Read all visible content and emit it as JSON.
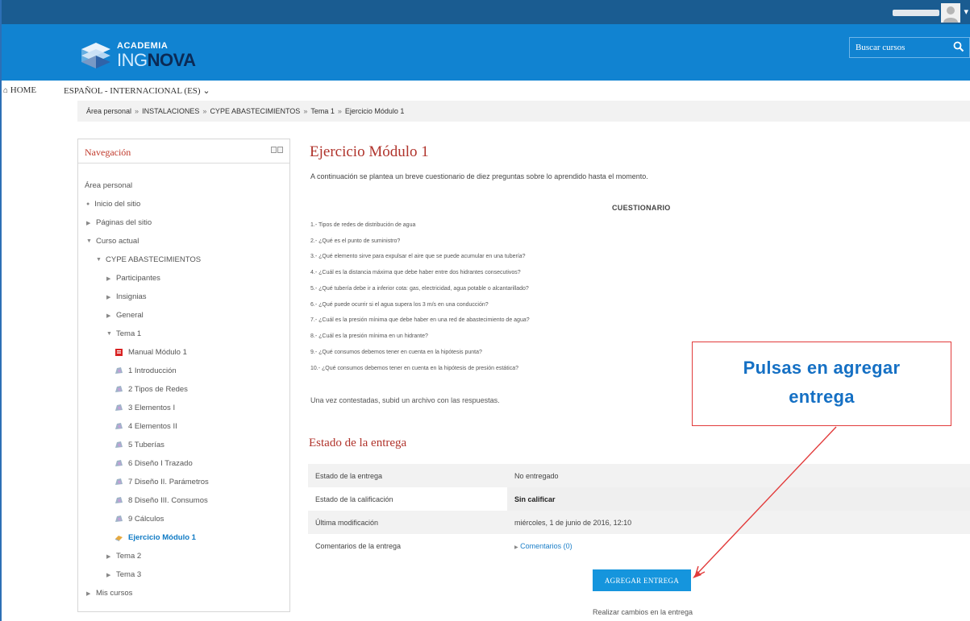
{
  "header": {
    "logo_line1": "ACADEMIA",
    "logo_ing": "ING",
    "logo_nova": "NOVA",
    "search_placeholder": "Buscar cursos"
  },
  "navbar": {
    "home": "HOME",
    "language": "ESPAÑOL - INTERNACIONAL (ES)"
  },
  "breadcrumb": [
    "Área personal",
    "INSTALACIONES",
    "CYPE ABASTECIMIENTOS",
    "Tema 1",
    "Ejercicio Módulo 1"
  ],
  "navigation": {
    "title": "Navegación",
    "items": [
      {
        "label": "Área personal"
      },
      {
        "label": "Inicio del sitio"
      },
      {
        "label": "Páginas del sitio"
      },
      {
        "label": "Curso actual"
      },
      {
        "label": "CYPE ABASTECIMIENTOS"
      },
      {
        "label": "Participantes"
      },
      {
        "label": "Insignias"
      },
      {
        "label": "General"
      },
      {
        "label": "Tema 1"
      },
      {
        "label": "Manual Módulo 1"
      },
      {
        "label": "1 Introducción"
      },
      {
        "label": "2 Tipos de Redes"
      },
      {
        "label": "3 Elementos I"
      },
      {
        "label": "4 Elementos II"
      },
      {
        "label": "5 Tuberías"
      },
      {
        "label": "6 Diseño I Trazado"
      },
      {
        "label": "7 Diseño II. Parámetros"
      },
      {
        "label": "8 Diseño III. Consumos"
      },
      {
        "label": "9 Cálculos"
      },
      {
        "label": "Ejercicio Módulo 1"
      },
      {
        "label": "Tema 2"
      },
      {
        "label": "Tema 3"
      },
      {
        "label": "Mis cursos"
      }
    ]
  },
  "main": {
    "title": "Ejercicio Módulo 1",
    "intro": "A continuación se plantea un breve cuestionario de diez preguntas sobre lo aprendido hasta el momento.",
    "cuestionario": "CUESTIONARIO",
    "questions": [
      "1.- Tipos de redes de distribución de agua",
      "2.- ¿Qué es el punto de suministro?",
      "3.- ¿Qué elemento sirve para expulsar el aire que se puede acumular en una tubería?",
      "4.- ¿Cuál es la distancia máxima que debe haber entre dos hidrantes consecutivos?",
      "5.-  ¿Qué  tubería debe ir a inferior cota: gas, electricidad, agua potable o alcantarillado?",
      "6.- ¿Qué puede ocurrir si el agua supera los 3 m/s en una conducción?",
      "7.- ¿Cuál es la presión mínima que debe haber en una red de abastecimiento de agua?",
      "8.- ¿Cuál es la presión mínima en un hidrante?",
      "9.- ¿Qué consumos debemos tener en cuenta en la hipótesis punta?",
      "10.- ¿Qué consumos debemos tener en cuenta en la hipótesis de presión estática?"
    ],
    "answer_note": "Una vez contestadas, subid un archivo con las respuestas.",
    "status_title": "Estado de la entrega",
    "status_rows": [
      {
        "label": "Estado de la entrega",
        "value": "No entregado"
      },
      {
        "label": "Estado de la calificación",
        "value": "Sin calificar"
      },
      {
        "label": "Última modificación",
        "value": "miércoles, 1 de junio de 2016, 12:10"
      },
      {
        "label": "Comentarios de la entrega",
        "value": "Comentarios (0)"
      }
    ],
    "add_button": "AGREGAR ENTREGA",
    "add_note": "Realizar cambios en la entrega"
  },
  "callout": {
    "line1": "Pulsas en agregar",
    "line2": "entrega"
  },
  "colors": {
    "topbar": "#1a5c91",
    "header": "#1183d1",
    "accent_red": "#b0332b",
    "button_blue": "#1595dd",
    "callout_text": "#1570c4",
    "arrow_red": "#e23b3b"
  }
}
